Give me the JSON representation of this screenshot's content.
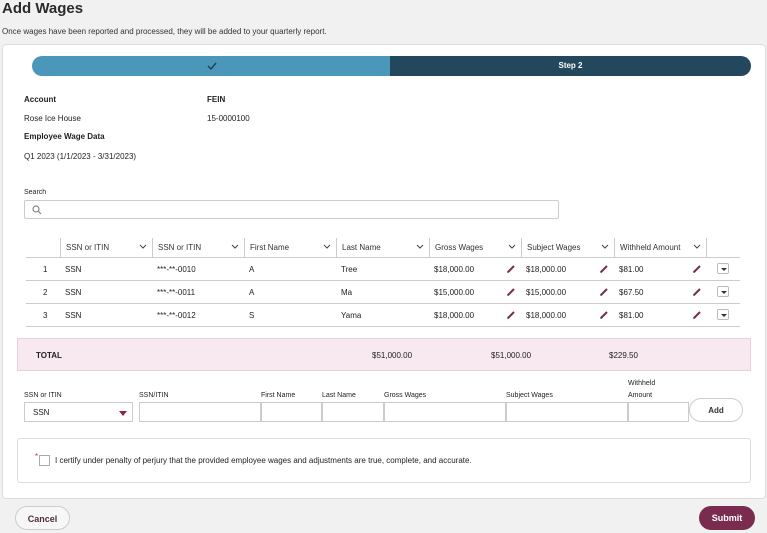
{
  "page": {
    "title": "Add Wages",
    "subtitle": "Once wages have been reported and processed, they will be added to your quarterly report."
  },
  "stepper": {
    "step1_icon": "check-icon",
    "step2_label": "Step 2",
    "colors": {
      "done": "#4a97ba",
      "current": "#23485d"
    }
  },
  "account": {
    "account_label": "Account",
    "account_value": "Rose Ice House",
    "fein_label": "FEIN",
    "fein_value": "15-0000100",
    "wage_data_label": "Employee Wage Data",
    "quarter": "Q1 2023 (1/1/2023 - 3/31/2023)"
  },
  "search": {
    "label": "Search",
    "placeholder": ""
  },
  "table": {
    "headers": [
      "SSN or ITIN",
      "SSN or ITIN",
      "First Name",
      "Last Name",
      "Gross Wages",
      "Subject Wages",
      "Withheld Amount"
    ],
    "rows": [
      {
        "num": "1",
        "type": "SSN",
        "ssn": "***-**-0010",
        "first": "A",
        "last": "Tree",
        "gross": "$18,000.00",
        "subject": "$18,000.00",
        "withheld": "$81.00"
      },
      {
        "num": "2",
        "type": "SSN",
        "ssn": "***-**-0011",
        "first": "A",
        "last": "Ma",
        "gross": "$15,000.00",
        "subject": "$15,000.00",
        "withheld": "$67.50"
      },
      {
        "num": "3",
        "type": "SSN",
        "ssn": "***-**-0012",
        "first": "S",
        "last": "Yama",
        "gross": "$18,000.00",
        "subject": "$18,000.00",
        "withheld": "$81.00"
      }
    ]
  },
  "total": {
    "label": "TOTAL",
    "gross": "$51,000.00",
    "subject": "$51,000.00",
    "withheld": "$229.50"
  },
  "add_form": {
    "ssn_type_label": "SSN or ITIN",
    "ssn_type_value": "SSN",
    "ssn_label": "SSN/ITIN",
    "first_label": "First Name",
    "last_label": "Last Name",
    "gross_label": "Gross Wages",
    "subject_label": "Subject Wages",
    "withheld_label_1": "Withheld",
    "withheld_label_2": "Amount",
    "add_button": "Add"
  },
  "certify": {
    "asterisk": "*",
    "text": "I certify under penalty of perjury that the provided employee wages and adjustments are true, complete, and accurate."
  },
  "footer": {
    "cancel": "Cancel",
    "submit": "Submit",
    "submit_color": "#7a2c4f"
  }
}
